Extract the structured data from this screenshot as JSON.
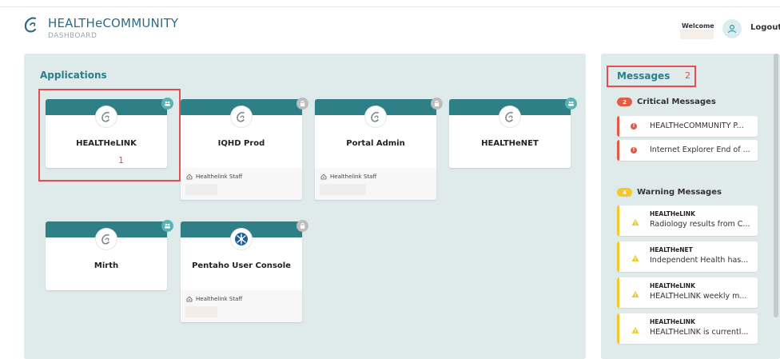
{
  "header": {
    "brand_title": "HEALTHeCOMMUNITY",
    "brand_subtitle": "DASHBOARD",
    "welcome_label": "Welcome",
    "logout_label": "Logout"
  },
  "applications": {
    "title": "Applications",
    "cards": [
      {
        "name": "HEALTHeLINK",
        "footer": ""
      },
      {
        "name": "IQHD Prod",
        "footer": "Healthelink Staff"
      },
      {
        "name": "Portal Admin",
        "footer": "Healthelink Staff"
      },
      {
        "name": "HEALTHeNET",
        "footer": ""
      },
      {
        "name": "Mirth",
        "footer": ""
      },
      {
        "name": "Pentaho User Console",
        "footer": "Healthelink Staff"
      }
    ]
  },
  "annotations": {
    "one": "1",
    "two": "2"
  },
  "messages": {
    "title": "Messages",
    "critical": {
      "label": "Critical Messages",
      "count": "2",
      "items": [
        {
          "text": "HEALTHeCOMMUNITY P..."
        },
        {
          "text": "Internet Explorer End of ..."
        }
      ]
    },
    "warning": {
      "label": "Warning Messages",
      "count": "4",
      "items": [
        {
          "source": "HEALTHeLINK",
          "text": "Radiology results from C..."
        },
        {
          "source": "HEALTHeNET",
          "text": "Independent Health has..."
        },
        {
          "source": "HEALTHeLINK",
          "text": "HEALTHeLINK weekly m..."
        },
        {
          "source": "HEALTHeLINK",
          "text": "HEALTHeLINK is currentl..."
        }
      ]
    }
  },
  "colors": {
    "brand": "#2e6b86",
    "card_header": "#2f7f86",
    "panel_bg": "#dfeaeb",
    "critical": "#e05a46",
    "warning": "#f2c82e",
    "highlight": "#e05050"
  },
  "icons": {
    "logo": "healthecommunity-logo-icon",
    "user": "user-icon",
    "shared_badge": "users-badge-icon",
    "locked_badge": "lock-badge-icon",
    "staff": "home-icon",
    "critical": "exclamation-icon",
    "warning": "warning-triangle-icon",
    "pentaho": "pentaho-logo-icon"
  }
}
